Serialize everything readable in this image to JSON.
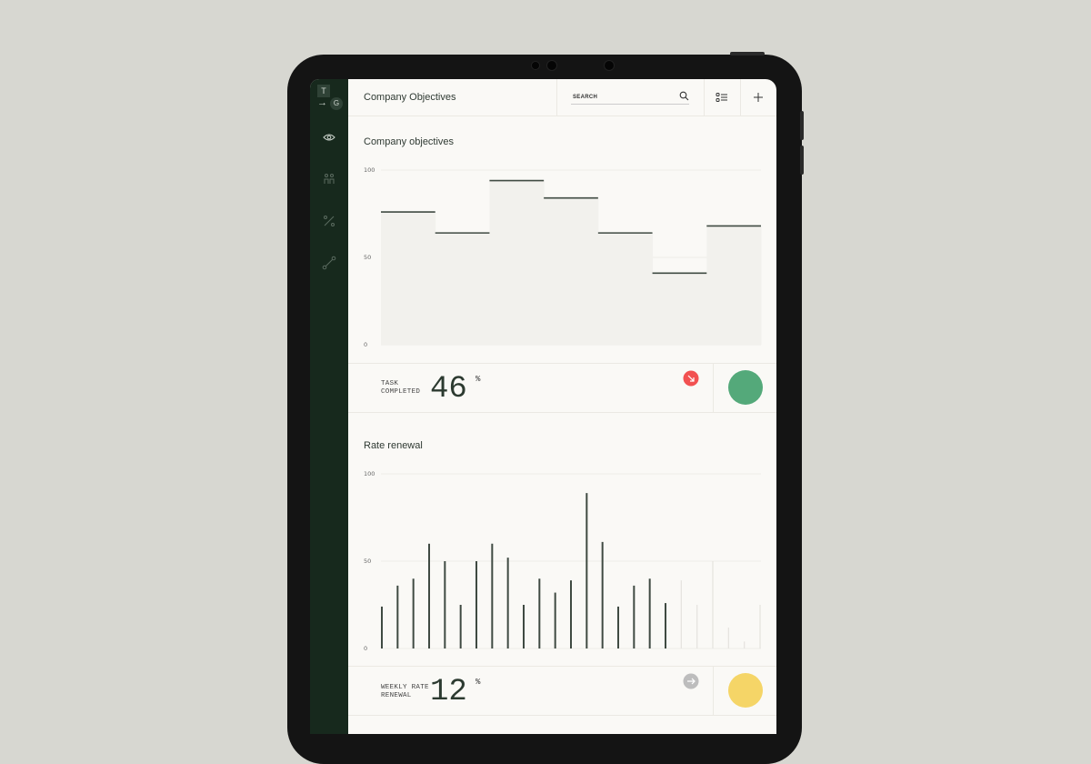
{
  "header": {
    "title": "Company Objectives",
    "search_placeholder": "SEARCH"
  },
  "sidebar": {
    "logo_top": "T",
    "logo_arrow": "→",
    "logo_bottom": "G",
    "items": [
      {
        "icon": "eye-icon"
      },
      {
        "icon": "people-icon"
      },
      {
        "icon": "percent-icon"
      },
      {
        "icon": "connection-icon"
      }
    ]
  },
  "colors": {
    "sidebar": "#17291d",
    "bars": "#3f4a42",
    "down_badge": "#f25151",
    "green_dot": "#54a97a",
    "yellow_dot": "#f5d567",
    "neutral_badge": "#bdbdbd"
  },
  "sections": [
    {
      "title": "Company objectives",
      "stat_label_1": "TASK",
      "stat_label_2": "COMPLETED",
      "stat_value": "46",
      "stat_unit": "%",
      "trend": "down"
    },
    {
      "title": "Rate renewal",
      "stat_label_1": "WEEKLY RATE",
      "stat_label_2": "RENEWAL",
      "stat_value": "12",
      "stat_unit": "%",
      "trend": "flat"
    }
  ],
  "chart_data": [
    {
      "type": "area",
      "title": "Company objectives",
      "yticks": [
        "100",
        "50",
        "0"
      ],
      "ylim": [
        0,
        100
      ],
      "grid": true,
      "values": [
        76,
        64,
        94,
        84,
        64,
        41,
        68
      ]
    },
    {
      "type": "bar",
      "title": "Rate renewal",
      "yticks": [
        "100",
        "50",
        "0"
      ],
      "ylim": [
        0,
        100
      ],
      "grid": true,
      "values": [
        24,
        36,
        40,
        60,
        50,
        25,
        50,
        60,
        52,
        25,
        40,
        32,
        39,
        89,
        61,
        24,
        36,
        40,
        26
      ],
      "projected_values": [
        39,
        25,
        50,
        12,
        4,
        25
      ]
    }
  ]
}
